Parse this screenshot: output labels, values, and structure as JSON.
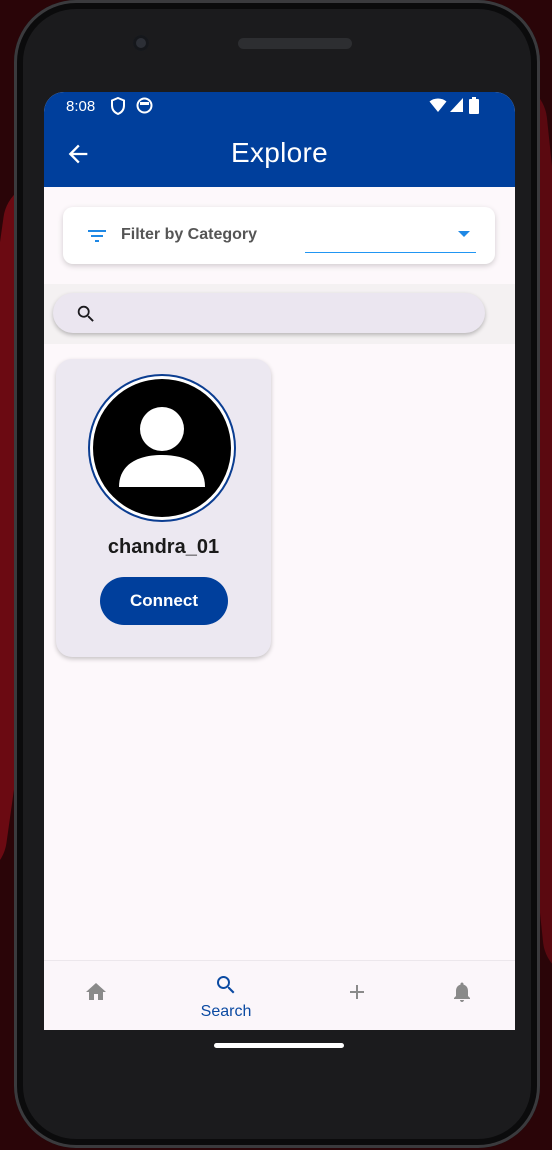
{
  "status_bar": {
    "time": "8:08"
  },
  "app_bar": {
    "title": "Explore"
  },
  "filter": {
    "label": "Filter by Category",
    "selected": ""
  },
  "search": {
    "placeholder": ""
  },
  "users": [
    {
      "username": "chandra_01",
      "action_label": "Connect"
    }
  ],
  "bottom_nav": {
    "items": [
      {
        "icon": "home-icon",
        "label": ""
      },
      {
        "icon": "search-icon",
        "label": "Search",
        "active": true
      },
      {
        "icon": "add-icon",
        "label": ""
      },
      {
        "icon": "bell-icon",
        "label": ""
      }
    ]
  },
  "colors": {
    "primary": "#003f9c",
    "accent": "#2196f3",
    "card": "#ece8f1",
    "background": "#fdf8fb"
  }
}
